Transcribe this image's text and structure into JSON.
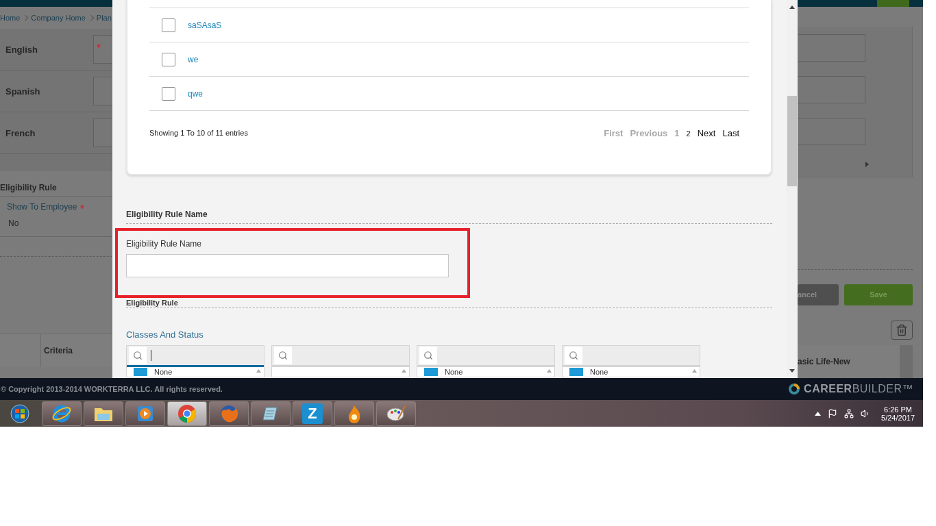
{
  "background_page": {
    "breadcrumb": [
      "Home",
      "Company Home",
      "Plan"
    ],
    "languages": [
      {
        "label": "English",
        "required": true
      },
      {
        "label": "Spanish",
        "required": false
      },
      {
        "label": "French",
        "required": false
      }
    ],
    "section_title": "Eligibility Rule",
    "show_to_employee": {
      "label": "Show To Employee",
      "required": true,
      "value": "No"
    },
    "buttons": [
      {
        "label": "ancel",
        "kind": "cancel"
      },
      {
        "label": "Save",
        "kind": "save"
      }
    ],
    "table_columns": [
      "Criteria",
      "asic Life-New"
    ]
  },
  "modal": {
    "rows": [
      {
        "label": "saSAsaS",
        "checked": false
      },
      {
        "label": "we",
        "checked": false
      },
      {
        "label": "qwe",
        "checked": false
      }
    ],
    "entries_info": "Showing 1 To 10 of 11 entries",
    "pagination": [
      {
        "label": "First",
        "disabled": true
      },
      {
        "label": "Previous",
        "disabled": true
      },
      {
        "label": "1",
        "disabled": true
      },
      {
        "label": "2",
        "disabled": false
      },
      {
        "label": "Next",
        "disabled": false
      },
      {
        "label": "Last",
        "disabled": false
      }
    ],
    "name_section": "Eligibility Rule Name",
    "name_field": {
      "label": "Eligibility Rule Name"
    },
    "rule_section": "Eligibility Rule",
    "classes_label": "Classes And Status",
    "selectors": [
      {
        "focused": true,
        "items": [
          {
            "label": "None",
            "checked": true
          }
        ]
      },
      {
        "focused": false
      },
      {
        "focused": false,
        "items": [
          {
            "label": "None",
            "checked": true
          }
        ]
      },
      {
        "focused": false,
        "items": [
          {
            "label": "None",
            "checked": true
          }
        ]
      }
    ]
  },
  "footer": {
    "copyright": "© Copyright 2013-2014 WORKTERRA LLC. All rights reserved.",
    "logo": "**CAREER**BUILDER™"
  },
  "taskbar": {
    "apps": [
      {
        "kind": "start",
        "selected": false
      },
      {
        "kind": "ie",
        "selected": false
      },
      {
        "kind": "folder",
        "selected": false
      },
      {
        "kind": "player",
        "selected": false
      },
      {
        "kind": "chrome",
        "selected": true
      },
      {
        "kind": "firefox",
        "selected": false
      },
      {
        "kind": "notepad",
        "selected": false
      },
      {
        "kind": "z",
        "label": "Z",
        "selected": false
      },
      {
        "kind": "flame",
        "selected": false
      },
      {
        "kind": "paint",
        "selected": false
      }
    ],
    "clock": {
      "time": "6:26 PM",
      "date": "5/24/2017"
    }
  }
}
